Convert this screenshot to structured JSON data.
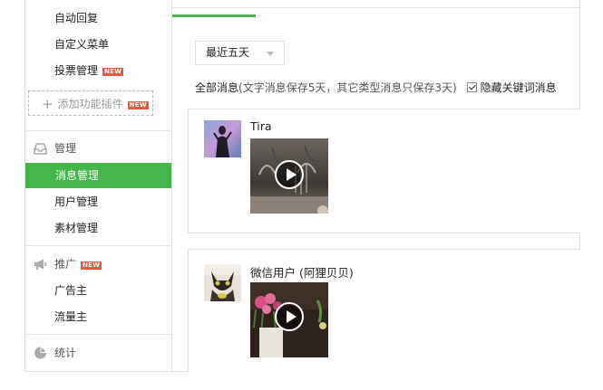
{
  "sidebar": {
    "items_top": [
      {
        "label": "自动回复"
      },
      {
        "label": "自定义菜单"
      },
      {
        "label": "投票管理",
        "badge": "NEW"
      }
    ],
    "add_plugin": {
      "label": "添加功能插件",
      "badge": "NEW"
    },
    "manage": {
      "header": "管理",
      "icon": "inbox-icon",
      "items": [
        {
          "label": "消息管理",
          "active": true
        },
        {
          "label": "用户管理"
        },
        {
          "label": "素材管理"
        }
      ]
    },
    "promote": {
      "header": "推广",
      "badge": "NEW",
      "icon": "megaphone-icon",
      "items": [
        {
          "label": "广告主"
        },
        {
          "label": "流量主"
        }
      ]
    },
    "stats": {
      "header": "统计",
      "icon": "pie-chart-icon"
    }
  },
  "toolbar": {
    "range_select": "最近五天",
    "all_label": "全部消息",
    "retention_note": "(文字消息保存5天，其它类型消息只保存3天)",
    "hide_keywords_label": "隐藏关键词消息",
    "hide_keywords_checked": true
  },
  "messages": [
    {
      "user": "Tira",
      "type": "video"
    },
    {
      "user": "微信用户 (阿狸贝贝)",
      "type": "video"
    }
  ],
  "colors": {
    "accent": "#44b549",
    "badge": "#e25b3f",
    "border": "#e1e1e1"
  }
}
